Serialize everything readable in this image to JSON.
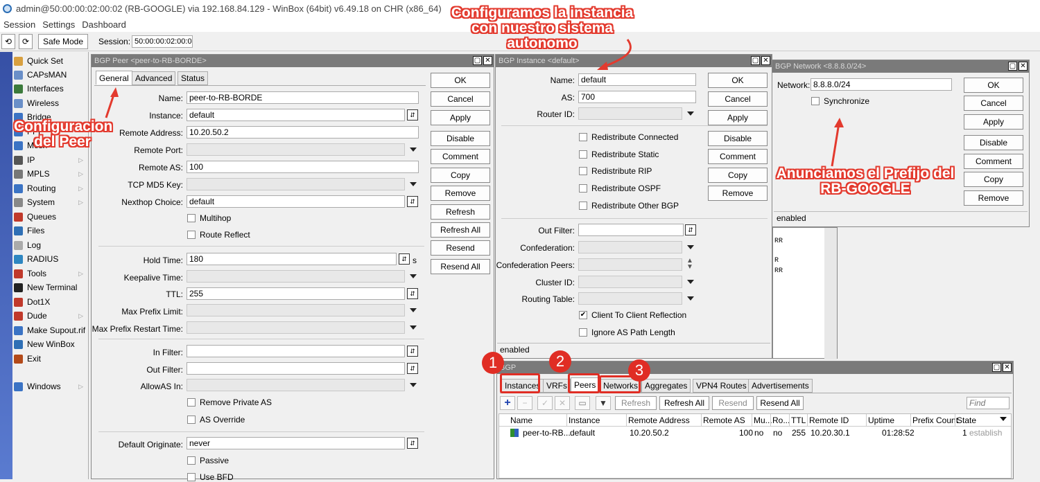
{
  "app": {
    "title": "admin@50:00:00:02:00:02 (RB-GOOGLE) via 192.168.84.129 - WinBox (64bit) v6.49.18 on CHR (x86_64)",
    "menu": [
      "Session",
      "Settings",
      "Dashboard"
    ],
    "safe_mode": "Safe Mode",
    "session_label": "Session:",
    "session_value": "50:00:00:02:00:02"
  },
  "sidebar": {
    "items": [
      {
        "label": "Quick Set",
        "color": "#d8a040",
        "arrow": false
      },
      {
        "label": "CAPsMAN",
        "color": "#6a8fc8",
        "arrow": false
      },
      {
        "label": "Interfaces",
        "color": "#3b7a3b",
        "arrow": false
      },
      {
        "label": "Wireless",
        "color": "#6a8fc8",
        "arrow": false
      },
      {
        "label": "Bridge",
        "color": "#3b73c4",
        "arrow": false
      },
      {
        "label": "PPP",
        "color": "#3b73c4",
        "arrow": false
      },
      {
        "label": "Mesh",
        "color": "#3b73c4",
        "arrow": false
      },
      {
        "label": "IP",
        "color": "#555",
        "arrow": true
      },
      {
        "label": "MPLS",
        "color": "#777",
        "arrow": true
      },
      {
        "label": "Routing",
        "color": "#3b73c4",
        "arrow": true
      },
      {
        "label": "System",
        "color": "#888",
        "arrow": true
      },
      {
        "label": "Queues",
        "color": "#c0392b",
        "arrow": false
      },
      {
        "label": "Files",
        "color": "#2f6fb5",
        "arrow": false
      },
      {
        "label": "Log",
        "color": "#aaa",
        "arrow": false
      },
      {
        "label": "RADIUS",
        "color": "#2e86c1",
        "arrow": false
      },
      {
        "label": "Tools",
        "color": "#c0392b",
        "arrow": true
      },
      {
        "label": "New Terminal",
        "color": "#222",
        "arrow": false
      },
      {
        "label": "Dot1X",
        "color": "#c0392b",
        "arrow": false
      },
      {
        "label": "Dude",
        "color": "#c0392b",
        "arrow": true
      },
      {
        "label": "Make Supout.rif",
        "color": "#3b73c4",
        "arrow": false
      },
      {
        "label": "New WinBox",
        "color": "#2f6fb5",
        "arrow": false
      },
      {
        "label": "Exit",
        "color": "#b34a1a",
        "arrow": false
      },
      {
        "label": "Windows",
        "color": "#3b73c4",
        "arrow": true
      }
    ]
  },
  "peer_win": {
    "title": "BGP Peer <peer-to-RB-BORDE>",
    "tabs": [
      "General",
      "Advanced",
      "Status"
    ],
    "fields": {
      "name_label": "Name:",
      "name": "peer-to-RB-BORDE",
      "instance_label": "Instance:",
      "instance": "default",
      "remote_address_label": "Remote Address:",
      "remote_address": "10.20.50.2",
      "remote_port_label": "Remote Port:",
      "remote_as_label": "Remote AS:",
      "remote_as": "100",
      "tcp_md5_label": "TCP MD5 Key:",
      "nexthop_label": "Nexthop Choice:",
      "nexthop": "default",
      "multihop": "Multihop",
      "route_reflect": "Route Reflect",
      "hold_time_label": "Hold Time:",
      "hold_time": "180",
      "hold_time_unit": "s",
      "keepalive_label": "Keepalive Time:",
      "ttl_label": "TTL:",
      "ttl": "255",
      "max_prefix_label": "Max Prefix Limit:",
      "max_prefix_restart_label": "Max Prefix Restart Time:",
      "in_filter_label": "In Filter:",
      "out_filter_label": "Out Filter:",
      "allowas_label": "AllowAS In:",
      "remove_private_as": "Remove Private AS",
      "as_override": "AS Override",
      "default_originate_label": "Default Originate:",
      "default_originate": "never",
      "passive": "Passive",
      "use_bfd": "Use BFD"
    },
    "buttons": [
      "OK",
      "Cancel",
      "Apply",
      "Disable",
      "Comment",
      "Copy",
      "Remove",
      "Refresh",
      "Refresh All",
      "Resend",
      "Resend All"
    ]
  },
  "instance_win": {
    "title": "BGP Instance <default>",
    "name_label": "Name:",
    "name": "default",
    "as_label": "AS:",
    "as": "700",
    "router_id_label": "Router ID:",
    "checks": [
      "Redistribute Connected",
      "Redistribute Static",
      "Redistribute RIP",
      "Redistribute OSPF",
      "Redistribute Other BGP"
    ],
    "out_filter_label": "Out Filter:",
    "confederation_label": "Confederation:",
    "confed_peers_label": "Confederation Peers:",
    "cluster_id_label": "Cluster ID:",
    "routing_table_label": "Routing Table:",
    "client_reflection": "Client To Client Reflection",
    "ignore_as_path": "Ignore AS Path Length",
    "status": "enabled",
    "buttons": [
      "OK",
      "Cancel",
      "Apply",
      "Disable",
      "Comment",
      "Copy",
      "Remove"
    ]
  },
  "network_win": {
    "title": "BGP Network <8.8.8.0/24>",
    "network_label": "Network:",
    "network": "8.8.8.0/24",
    "synchronize": "Synchronize",
    "status": "enabled",
    "buttons": [
      "OK",
      "Cancel",
      "Apply",
      "Disable",
      "Comment",
      "Copy",
      "Remove"
    ]
  },
  "bg_log": [
    "RR",
    "R",
    "RR"
  ],
  "bgp_list": {
    "title": "BGP",
    "tabs": [
      "Instances",
      "VRFs",
      "Peers",
      "Networks",
      "Aggregates",
      "VPN4 Routes",
      "Advertisements"
    ],
    "toolbar": {
      "refresh": "Refresh",
      "refresh_all": "Refresh All",
      "resend": "Resend",
      "resend_all": "Resend All",
      "find_placeholder": "Find"
    },
    "columns": [
      "Name",
      "Instance",
      "Remote Address",
      "Remote AS",
      "Mu...",
      "Ro...",
      "TTL",
      "Remote ID",
      "Uptime",
      "Prefix Count",
      "State"
    ],
    "row": {
      "name": "peer-to-RB...",
      "instance": "default",
      "remote_address": "10.20.50.2",
      "remote_as": "100",
      "mu": "no",
      "ro": "no",
      "ttl": "255",
      "remote_id": "10.20.30.1",
      "uptime": "01:28:52",
      "prefix_count": "1",
      "state": "established"
    }
  },
  "annotations": {
    "instance_note": "Configuramos la instancia con nuestro sistema autonomo",
    "peer_note": "Configuracion del Peer",
    "network_note": "Anunciamos el Prefijo del RB-GOOGLE",
    "badge1": "1",
    "badge2": "2",
    "badge3": "3"
  }
}
